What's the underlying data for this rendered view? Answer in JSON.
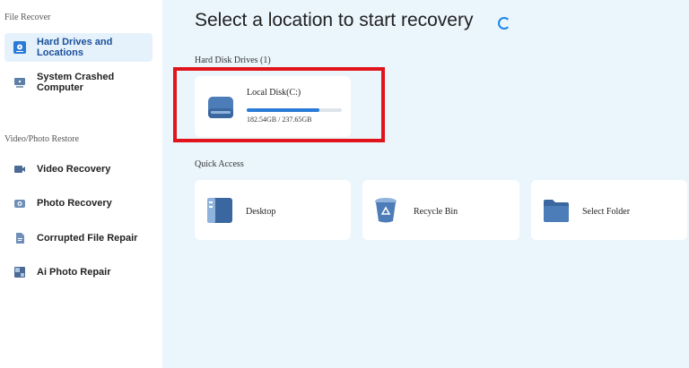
{
  "sidebar": {
    "file_recover_title": "File Recover",
    "video_photo_title": "Video/Photo Restore",
    "items": [
      {
        "label": "Hard Drives and Locations",
        "icon": "hard-drive-icon",
        "active": true
      },
      {
        "label": "System Crashed Computer",
        "icon": "monitor-icon"
      },
      {
        "label": "Video Recovery",
        "icon": "video-camera-icon"
      },
      {
        "label": "Photo Recovery",
        "icon": "camera-icon"
      },
      {
        "label": "Corrupted File Repair",
        "icon": "file-repair-icon"
      },
      {
        "label": "Ai Photo Repair",
        "icon": "ai-photo-icon"
      }
    ]
  },
  "main": {
    "title": "Select a location to start recovery",
    "hard_disk_title": "Hard Disk Drives (1)",
    "disk": {
      "name": "Local Disk(C:)",
      "size": "182.54GB / 237.65GB",
      "used_fraction": 0.768
    },
    "quick_access_title": "Quick Access",
    "quick_access": [
      {
        "label": "Desktop",
        "icon": "desktop-icon"
      },
      {
        "label": "Recycle Bin",
        "icon": "recycle-bin-icon"
      },
      {
        "label": "Select Folder",
        "icon": "folder-icon"
      }
    ]
  },
  "colors": {
    "accent": "#1e87e5",
    "highlight": "#e0141a",
    "main_bg": "#eaf5fc"
  }
}
